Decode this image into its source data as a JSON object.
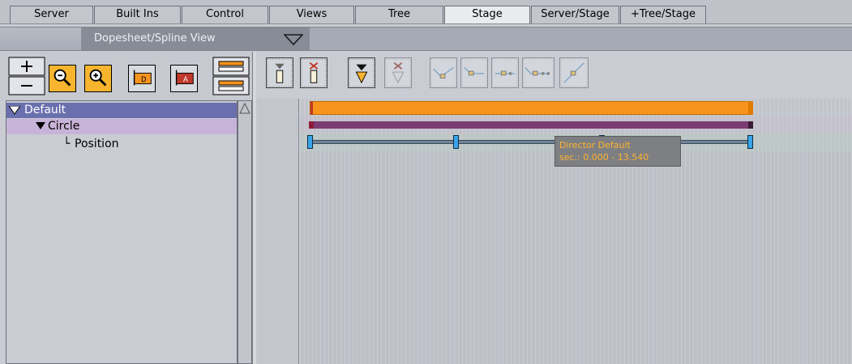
{
  "tabs": [
    {
      "label": "Server",
      "active": false
    },
    {
      "label": "Built Ins",
      "active": false
    },
    {
      "label": "Control",
      "active": false
    },
    {
      "label": "Views",
      "active": false
    },
    {
      "label": "Tree",
      "active": false
    },
    {
      "label": "Stage",
      "active": true
    },
    {
      "label": "Server/Stage",
      "active": false
    },
    {
      "label": "+Tree/Stage",
      "active": false
    }
  ],
  "view_selector": {
    "value": "Dopesheet/Spline View"
  },
  "tree": {
    "rows": [
      {
        "label": "Default",
        "prefix": "",
        "expanded": true
      },
      {
        "label": "Circle",
        "prefix": "",
        "expanded": true
      },
      {
        "label": "Position",
        "prefix": "└",
        "expanded": false
      }
    ]
  },
  "left_toolbar_icons": [
    "zoom-plus-minus-icon",
    "zoom-out-icon",
    "zoom-in-icon",
    "tag-director-icon",
    "tag-action-icon",
    "stack-toggle-icon"
  ],
  "right_toolbar_icons": [
    "add-keyframe-icon",
    "delete-keyframe-icon",
    "add-marker-icon",
    "delete-marker-icon",
    "spline-ease-in-icon",
    "spline-ease-out-icon",
    "spline-linear-icon",
    "spline-ease-both-icon",
    "spline-curve-icon"
  ],
  "timeline": {
    "director_bar_color": "#f7941d",
    "actor_bar_color": "#7a3d72",
    "key_color": "#3aa4e8",
    "tooltip": {
      "line1": "Director Default",
      "line2": "sec.: 0.000 - 13.540"
    }
  },
  "colors": {
    "tree_selected": "#6a6fae",
    "tree_child": "#c8b3d8",
    "tooltip_text": "#ffb32e"
  }
}
